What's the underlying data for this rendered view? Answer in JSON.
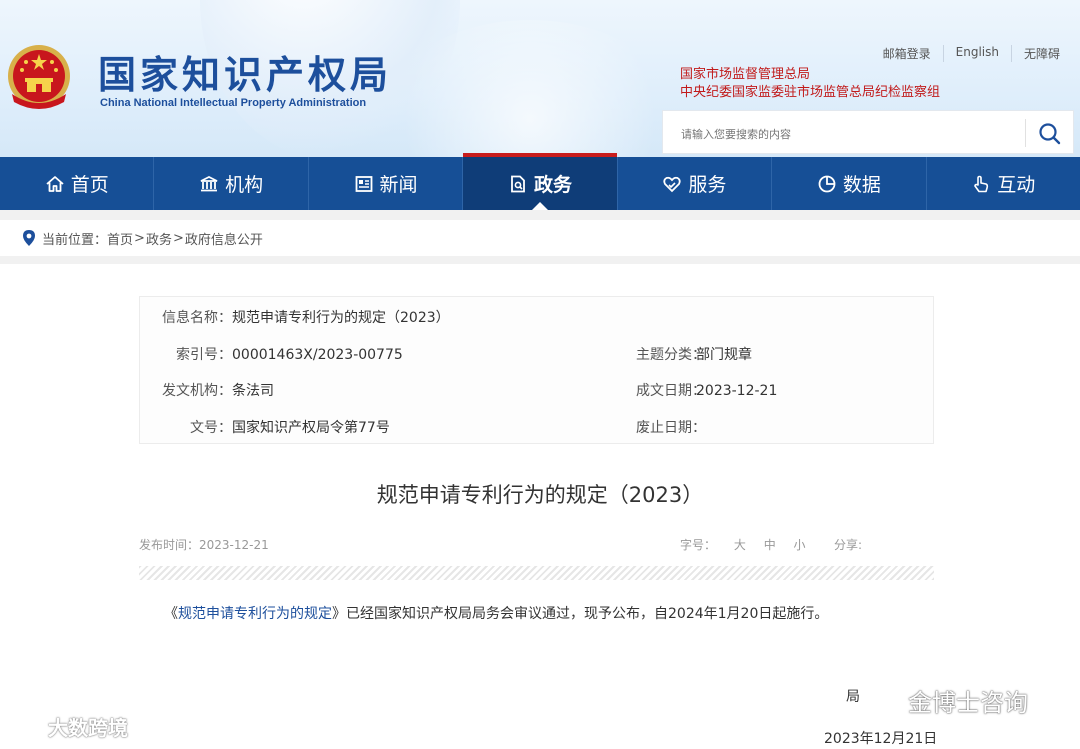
{
  "header": {
    "title_cn": "国家知识产权局",
    "title_en": "China National Intellectual Property Administration",
    "top_links": [
      "邮箱登录",
      "English",
      "无障碍"
    ],
    "red_links": [
      "国家市场监督管理总局",
      "中央纪委国家监委驻市场监管总局纪检监察组"
    ],
    "search_placeholder": "请输入您要搜索的内容"
  },
  "nav": {
    "items": [
      {
        "label": "首页",
        "icon": "home-icon"
      },
      {
        "label": "机构",
        "icon": "institution-icon"
      },
      {
        "label": "新闻",
        "icon": "news-icon"
      },
      {
        "label": "政务",
        "icon": "government-affairs-icon"
      },
      {
        "label": "服务",
        "icon": "service-icon"
      },
      {
        "label": "数据",
        "icon": "data-pie-icon"
      },
      {
        "label": "互动",
        "icon": "interaction-hand-icon"
      }
    ],
    "active": "政务"
  },
  "breadcrumb": {
    "prefix": "当前位置：",
    "items": [
      "首页",
      "政务",
      "政府信息公开"
    ],
    "separator": ">"
  },
  "info": {
    "name_label": "信息名称：",
    "name_value": "规范申请专利行为的规定（2023）",
    "index_label": "索引号：",
    "index_value": "00001463X/2023-00775",
    "topic_label": "主题分类：",
    "topic_value": "部门规章",
    "issuer_label": "发文机构：",
    "issuer_value": "条法司",
    "date_label": "成文日期：",
    "date_value": "2023-12-21",
    "docno_label": "文号：",
    "docno_value": "国家知识产权局令第77号",
    "expiry_label": "废止日期：",
    "expiry_value": ""
  },
  "article": {
    "title": "规范申请专利行为的规定（2023）",
    "publish_label": "发布时间：",
    "publish_date": "2023-12-21",
    "font_size_label": "字号：",
    "font_sizes": [
      "大",
      "中",
      "小"
    ],
    "share_label": "分享:",
    "body_prefix": "《",
    "body_link": "规范申请专利行为的规定",
    "body_rest": "》已经国家知识产权局局务会审议通过，现予公布，自2024年1月20日起施行。",
    "signature": "局",
    "sign_date": "2023年12月21日"
  },
  "watermarks": {
    "left": "大数跨境",
    "right": "金博士咨询"
  },
  "colors": {
    "nav_bg": "#164f96",
    "nav_active": "#0f3d78",
    "accent_red": "#c81d1d",
    "logo_blue": "#1d4f9c"
  }
}
